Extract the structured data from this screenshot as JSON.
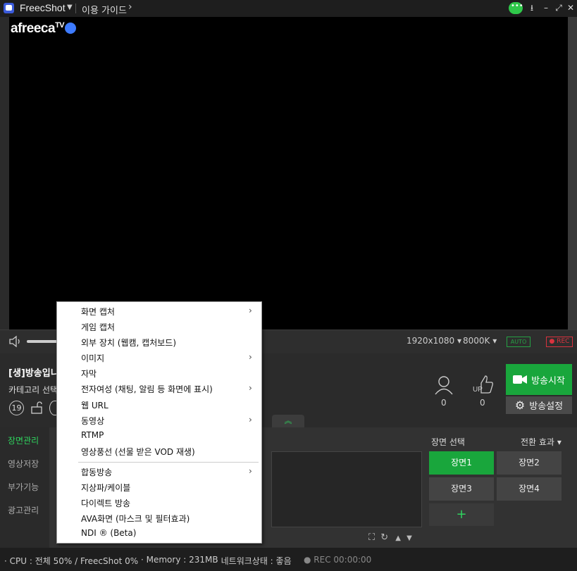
{
  "titlebar": {
    "app_name": "FreecShot",
    "guide": "이용 가이드",
    "guide_arrow": "›"
  },
  "logo": {
    "text": "afreeca",
    "tv": "TV"
  },
  "controls": {
    "resolution": "1920x1080",
    "bitrate": "8000K",
    "auto": "AUTO",
    "rec": "● REC"
  },
  "broadcast": {
    "title": "[생]방송입니",
    "category": "카테고리 선택",
    "age_badge": "19",
    "viewers": "0",
    "up": "0",
    "start_label": "방송시작",
    "settings_label": "방송설정"
  },
  "leftnav": {
    "items": [
      {
        "label": "장면관리",
        "active": true
      },
      {
        "label": "영상저장",
        "active": false
      },
      {
        "label": "부가기능",
        "active": false
      },
      {
        "label": "광고관리",
        "active": false
      }
    ]
  },
  "scenes": {
    "header": "장면 선택",
    "transition": "전환 효과",
    "buttons": [
      {
        "label": "장면1",
        "active": true
      },
      {
        "label": "장면2",
        "active": false
      },
      {
        "label": "장면3",
        "active": false
      },
      {
        "label": "장면4",
        "active": false
      }
    ],
    "add": "+"
  },
  "status": {
    "cpu": "· CPU : 전체 50% /  FreecShot  0%",
    "memory": "· Memory : 231MB",
    "network": "· 네트워크상태 : 좋음",
    "rec": "● REC  00:00:00"
  },
  "menu": {
    "items": [
      {
        "label": "화면 캡처",
        "submenu": true
      },
      {
        "label": "게임 캡처",
        "submenu": false
      },
      {
        "label": "외부 장치 (웹캠, 캡처보드)",
        "submenu": false
      },
      {
        "label": "이미지",
        "submenu": true
      },
      {
        "label": "자막",
        "submenu": false
      },
      {
        "label": "전자여성 (채팅, 알림 등 화면에 표시)",
        "submenu": true
      },
      {
        "label": "웹 URL",
        "submenu": false
      },
      {
        "label": "동영상",
        "submenu": true
      },
      {
        "label": "RTMP",
        "submenu": false
      },
      {
        "label": "영상풍선 (선물 받은 VOD 재생)",
        "submenu": false
      },
      {
        "label": "합동방송",
        "submenu": true
      },
      {
        "label": "지상파/케이블",
        "submenu": false
      },
      {
        "label": "다이렉트 방송",
        "submenu": false
      },
      {
        "label": "AVA화면 (마스크 및 필터효과)",
        "submenu": false
      },
      {
        "label": "NDI ® (Beta)",
        "submenu": false
      }
    ]
  },
  "colors": {
    "accent_green": "#19a63c",
    "text_green": "#2fd35e",
    "rec_red": "#d9333f"
  }
}
